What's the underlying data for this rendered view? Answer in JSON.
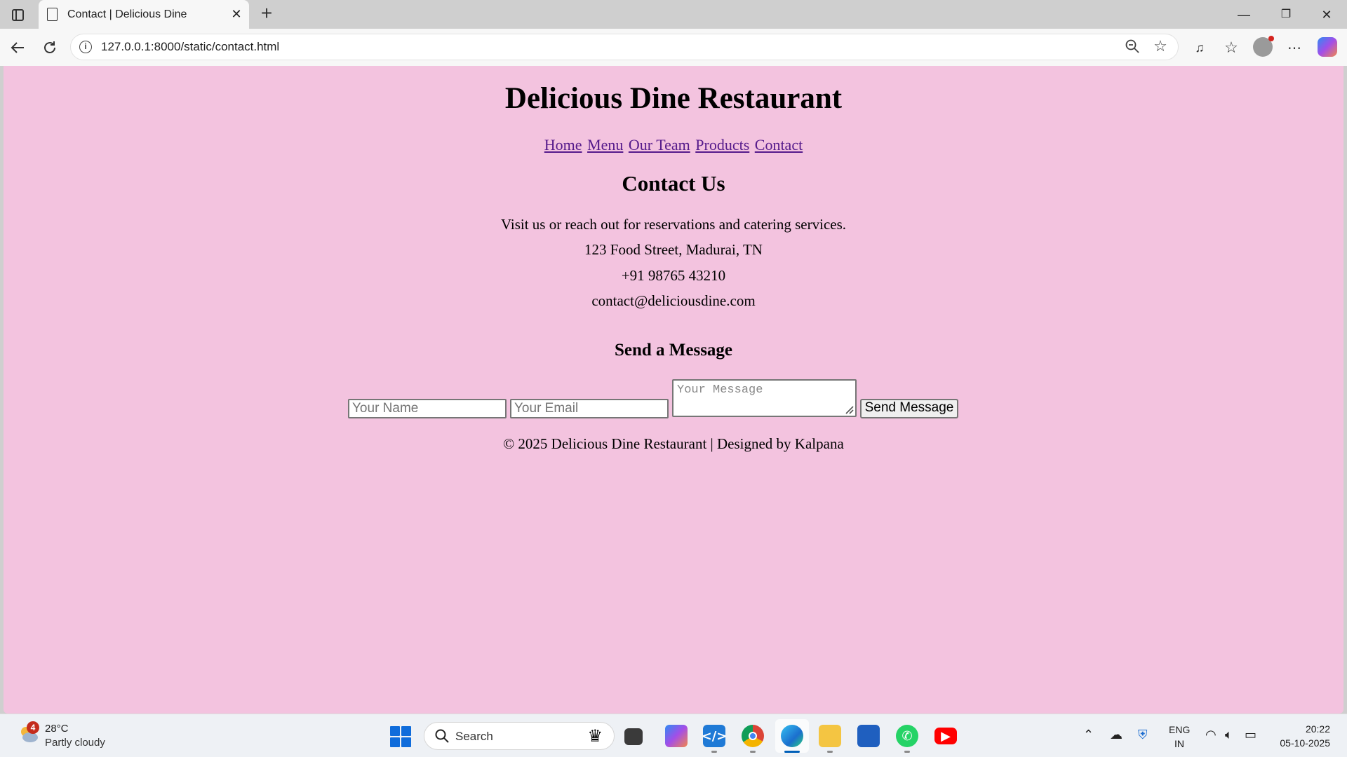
{
  "browser": {
    "tab_title": "Contact | Delicious Dine",
    "tab_close": "✕",
    "new_tab": "+",
    "url": "127.0.0.1:8000/static/contact.html",
    "window_controls": [
      "—",
      "❐",
      "✕"
    ],
    "icons": [
      "back-arrow-icon",
      "refresh-icon",
      "info-icon",
      "zoom-out-icon",
      "favorite-star-icon",
      "read-aloud-icon",
      "favorites-icon",
      "profile-icon",
      "more-icon",
      "copilot-icon"
    ]
  },
  "page": {
    "site_title": "Delicious Dine Restaurant",
    "nav": [
      "Home",
      "Menu",
      "Our Team",
      "Products",
      "Contact"
    ],
    "contact_heading": "Contact Us",
    "intro": "Visit us or reach out for reservations and catering services.",
    "address": "123 Food Street, Madurai, TN",
    "phone": "+91 98765 43210",
    "email": "contact@deliciousdine.com",
    "send_heading": "Send a Message",
    "form": {
      "name_placeholder": "Your Name",
      "email_placeholder": "Your Email",
      "message_placeholder": "Your Message",
      "submit_label": "Send Message"
    },
    "footer": "© 2025 Delicious Dine Restaurant | Designed by Kalpana",
    "colors": {
      "background": "#f3c3df",
      "link": "#551a8b"
    }
  },
  "taskbar": {
    "weather_badge": "4",
    "weather_temp": "28°C",
    "weather_desc": "Partly cloudy",
    "search_label": "Search",
    "lang_line1": "ENG",
    "lang_line2": "IN",
    "time": "20:22",
    "date": "05-10-2025",
    "apps": [
      "windows-start-icon",
      "task-view-icon",
      "copilot-app-icon",
      "vscode-icon",
      "chrome-icon",
      "edge-icon",
      "file-explorer-icon",
      "microsoft-store-icon",
      "whatsapp-icon",
      "youtube-icon"
    ]
  }
}
